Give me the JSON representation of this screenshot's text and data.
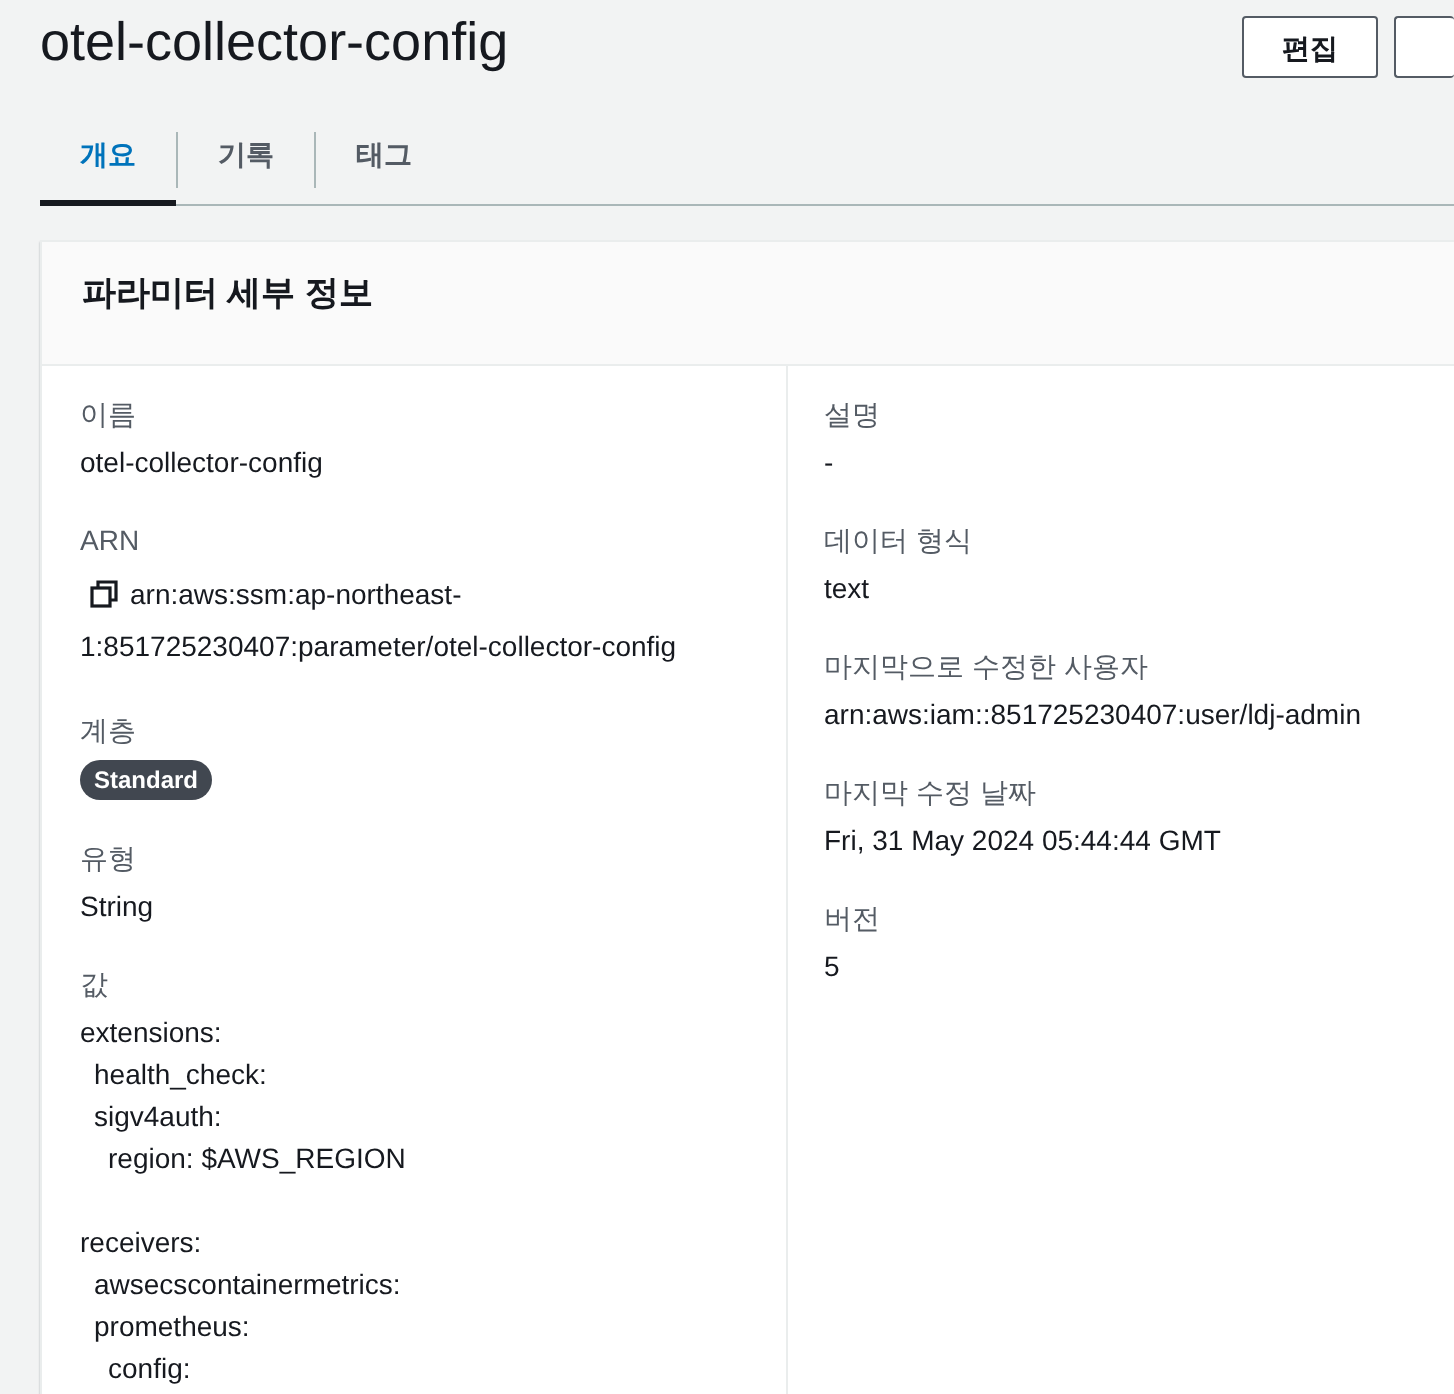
{
  "page_title": "otel-collector-config",
  "buttons": [
    {
      "label": "편집",
      "cut_off": false
    },
    {
      "cut_off": true
    }
  ],
  "tabs": [
    {
      "label": "개요",
      "selected": true
    },
    {
      "label": "기록",
      "selected": false
    },
    {
      "label": "태그",
      "selected": false
    }
  ],
  "panel": {
    "title": "파라미터 세부 정보",
    "left_fields": [
      {
        "kind": "text",
        "label": "이름",
        "value": "otel-collector-config"
      },
      {
        "kind": "copy",
        "label": "ARN",
        "lines": [
          "arn:aws:ssm:ap-northeast-",
          "1:851725230407:parameter/otel-collector-config"
        ]
      },
      {
        "kind": "badge",
        "label": "계층",
        "value": "Standard"
      },
      {
        "kind": "text",
        "label": "유형",
        "value": "String"
      },
      {
        "kind": "code",
        "label": "값",
        "blocks": [
          {
            "text": "extensions:",
            "children": [
              {
                "text": "health_check:"
              },
              {
                "text": "sigv4auth:",
                "children": [
                  {
                    "text": "region: $AWS_REGION"
                  }
                ]
              }
            ]
          },
          {
            "text": "receivers:",
            "children": [
              {
                "text": "awsecscontainermetrics:"
              },
              {
                "text": "prometheus:",
                "children": [
                  {
                    "text": "config:"
                  }
                ]
              }
            ]
          }
        ]
      }
    ],
    "right_fields": [
      {
        "kind": "text",
        "label": "설명",
        "value": "-"
      },
      {
        "kind": "text",
        "label": "데이터 형식",
        "value": "text"
      },
      {
        "kind": "text",
        "label": "마지막으로 수정한 사용자",
        "value": "arn:aws:iam::851725230407:user/ldj-admin"
      },
      {
        "kind": "text",
        "label": "마지막 수정 날짜",
        "value": "Fri, 31 May 2024 05:44:44 GMT"
      },
      {
        "kind": "text",
        "label": "버전",
        "value": "5"
      }
    ]
  }
}
